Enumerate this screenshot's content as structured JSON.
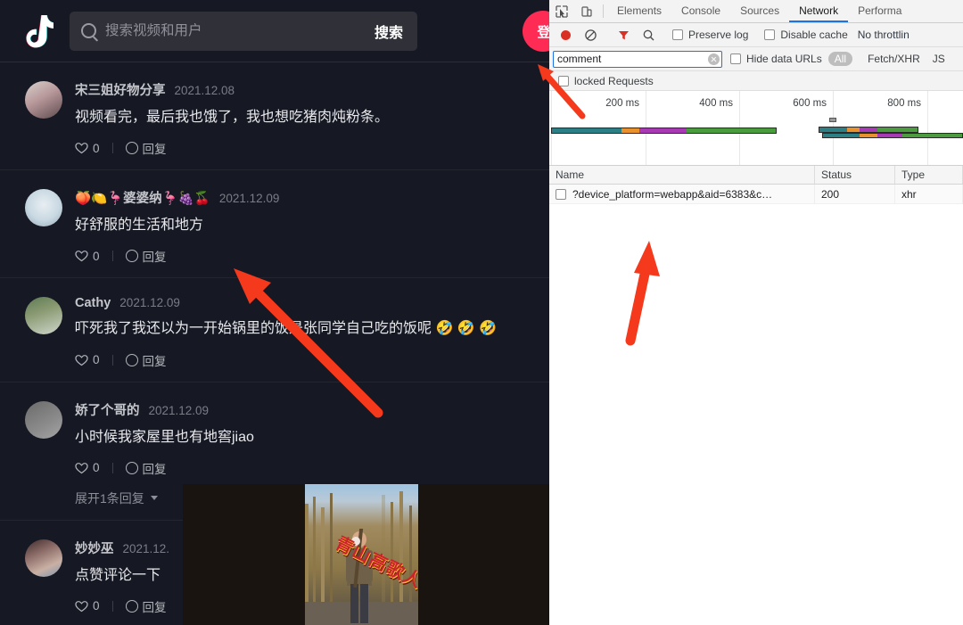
{
  "douyin": {
    "logo_icon": "douyin-music-note-logo",
    "search": {
      "placeholder": "搜索视频和用户",
      "value": "",
      "button_label": "搜索",
      "icon": "search-icon"
    },
    "login_label": "登",
    "comments": [
      {
        "name": "宋三姐好物分享",
        "date": "2021.12.08",
        "text": "视频看完，最后我也饿了，我也想吃猪肉炖粉条。",
        "likes": "0",
        "reply_label": "回复",
        "expand_label": ""
      },
      {
        "name": "🍑🍋🦩婆婆纳🦩🍇🍒",
        "date": "2021.12.09",
        "text": "好舒服的生活和地方",
        "likes": "0",
        "reply_label": "回复",
        "expand_label": ""
      },
      {
        "name": "Cathy",
        "date": "2021.12.09",
        "text": "吓死我了我还以为一开始锅里的饭是张同学自己吃的饭呢 🤣 🤣 🤣",
        "likes": "0",
        "reply_label": "回复",
        "expand_label": ""
      },
      {
        "name": "娇了个哥的",
        "date": "2021.12.09",
        "text": "小时候我家屋里也有地窖jiao",
        "likes": "0",
        "reply_label": "回复",
        "expand_label": "展开1条回复"
      },
      {
        "name": "妙妙巫",
        "date": "2021.12.",
        "text": "点赞评论一下",
        "likes": "0",
        "reply_label": "回复",
        "expand_label": ""
      }
    ],
    "video_overlay": {
      "title_text": "青山高歌人"
    }
  },
  "devtools": {
    "toolbar_icons": [
      "inspect-element-icon",
      "device-toolbar-icon"
    ],
    "tabs": [
      {
        "label": "Elements",
        "active": false
      },
      {
        "label": "Console",
        "active": false
      },
      {
        "label": "Sources",
        "active": false
      },
      {
        "label": "Network",
        "active": true
      },
      {
        "label": "Performa",
        "active": false
      }
    ],
    "network_bar": {
      "record_icon": "record-icon",
      "clear_icon": "clear-icon",
      "filter_icon": "filter-funnel-icon",
      "search_icon": "search-icon",
      "preserve_log_label": "Preserve log",
      "preserve_log_checked": false,
      "disable_cache_label": "Disable cache",
      "disable_cache_checked": false,
      "throttling_label": "No throttlin"
    },
    "filter_bar": {
      "filter_value": "comment",
      "clear_icon": "clear-filter-icon",
      "hide_data_urls_label": "Hide data URLs",
      "hide_data_urls_checked": false,
      "types": [
        {
          "label": "All",
          "selected": true
        },
        {
          "label": "Fetch/XHR",
          "selected": false
        },
        {
          "label": "JS",
          "selected": false
        }
      ]
    },
    "blocked_requests_label": "locked Requests",
    "overview": {
      "tick_labels": [
        "200 ms",
        "400 ms",
        "600 ms",
        "800 ms"
      ]
    },
    "table": {
      "columns": [
        "Name",
        "Status",
        "Type"
      ],
      "rows": [
        {
          "name": "?device_platform=webapp&aid=6383&c…",
          "status": "200",
          "type": "xhr"
        }
      ]
    }
  },
  "annotations": {
    "arrow_color": "#f4391c",
    "arrows": [
      "arrow-to-filter-input",
      "arrow-to-comment-area",
      "arrow-to-request-row"
    ]
  },
  "colors": {
    "douyin_bg": "#161823",
    "douyin_accent": "#fe2c55",
    "devtools_bg": "#ffffff",
    "devtools_tab_active": "#1a73e8",
    "arrow_red": "#f4391c"
  }
}
